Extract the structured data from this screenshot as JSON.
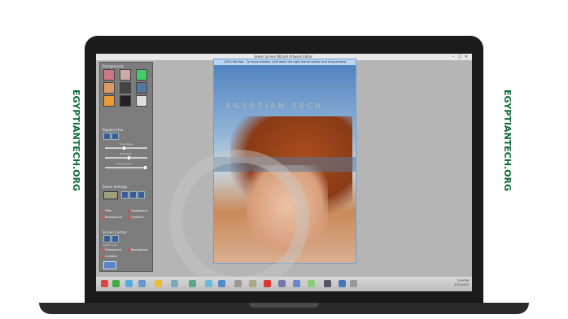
{
  "window": {
    "title": "Green Screen Wizard Artwork Editor",
    "controls": [
      "–",
      "□",
      "✕"
    ]
  },
  "panel": {
    "backgrounds_title": "Backgrounds",
    "replace_title": "Replace Hue",
    "slider_labels": [
      "Hue Range",
      "Reflection",
      "Transparency"
    ],
    "select_title": "Select Settings",
    "radio_left": [
      "Filter",
      "Background"
    ],
    "radio_right": [
      "Foreground",
      "Combine"
    ],
    "screen_title": "Screen Control",
    "screen_sub": "Select Layer",
    "screen_radios": [
      "Foreground",
      "Background",
      "Combine"
    ]
  },
  "photo": {
    "caption": "100% Window - To move window, hold down the right mouse button and drag window"
  },
  "watermark_text": "EGYPTIAN TECH",
  "side_text": "EGYPTIANTECH.ORG",
  "taskbar": {
    "time": "1:09 PM",
    "date": "1/21/2013"
  }
}
